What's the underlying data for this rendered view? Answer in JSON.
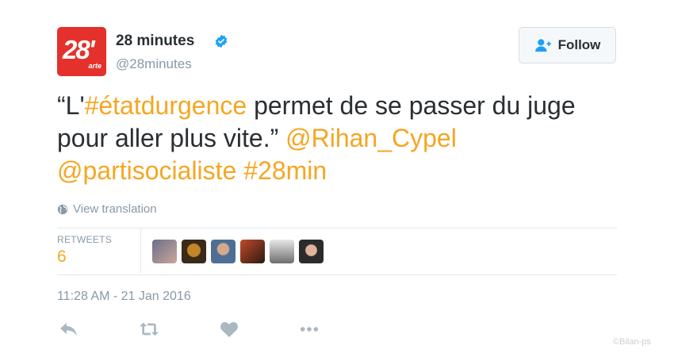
{
  "account": {
    "avatar_text": "28'",
    "avatar_subtext": "arte",
    "name": "28 minutes",
    "handle": "@28minutes",
    "verified": true
  },
  "follow_button": {
    "label": "Follow",
    "icon": "add-user-icon"
  },
  "tweet": {
    "parts": [
      "“L'",
      "#étatdurgence",
      " permet de se passer du juge pour aller plus vite.” ",
      "@Rihan_Cypel",
      " ",
      "@partisocialiste",
      " ",
      "#28min"
    ]
  },
  "translation": {
    "label": "View translation",
    "icon": "globe-icon"
  },
  "stats": {
    "retweets_label": "RETWEETS",
    "retweets_count": "6",
    "retweeter_avatar_colors": [
      "#6b6f8a",
      "#3a2a18",
      "#4e6f95",
      "#c24a2a",
      "#8e8e8e",
      "#2b2b2b"
    ]
  },
  "timestamp": "11:28 AM - 21 Jan 2016",
  "actions": [
    "reply-icon",
    "retweet-icon",
    "like-icon",
    "more-icon"
  ],
  "watermark": "©Bilan-ps",
  "colors": {
    "accent": "#f5a623",
    "muted": "#8899a6",
    "text": "#292f33",
    "verified": "#1da1f2",
    "avatar_bg": "#e4312b"
  }
}
